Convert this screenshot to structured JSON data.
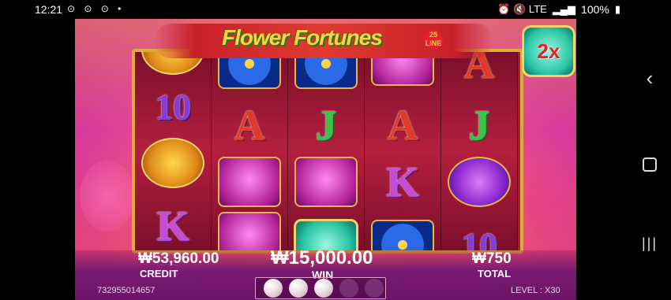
{
  "status_bar": {
    "time": "12:21",
    "left_icons": "⊙ ⊙ ⊙ •",
    "right_icons": "⏰ 🔇 LTE",
    "battery": "100%"
  },
  "game": {
    "title": "Flower Fortunes",
    "lines_badge": "25 LINE",
    "multiplier": "2x",
    "reels": [
      [
        "phoenix-symbol",
        "10",
        "phoenix-symbol",
        "K"
      ],
      [
        "flower-symbol",
        "A",
        "bird-symbol",
        "bird-symbol"
      ],
      [
        "flower-symbol",
        "J",
        "bird-symbol",
        "gem-symbol"
      ],
      [
        "bird-symbol",
        "A",
        "K",
        "flower-symbol"
      ],
      [
        "A",
        "J",
        "beetle-symbol",
        "10"
      ]
    ],
    "credit_value": "₩53,960.00",
    "credit_label": "CREDIT",
    "win_value": "₩15,000.00",
    "win_label": "WIN",
    "total_value": "₩750",
    "total_label": "TOTAL",
    "game_id": "732955014657",
    "level": "LEVEL : X30",
    "pearls": {
      "lit": 3,
      "total": 5
    }
  },
  "nav": {
    "back_icon": "back-icon",
    "home_icon": "home-icon",
    "recent_icon": "recent-apps-icon"
  }
}
